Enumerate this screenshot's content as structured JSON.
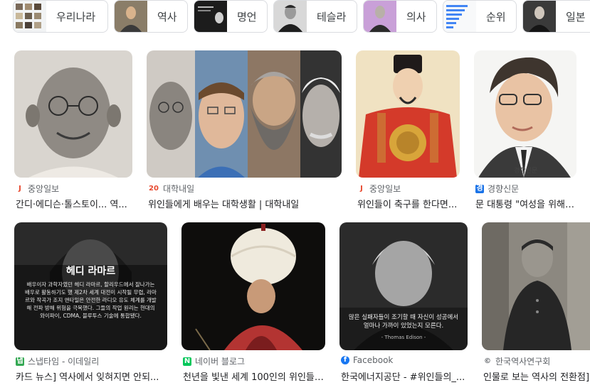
{
  "chips": [
    {
      "label": "우리나라",
      "icon": "world-map-thumbnail"
    },
    {
      "label": "역사",
      "icon": "portrait-thumbnail"
    },
    {
      "label": "명언",
      "icon": "quote-card-thumbnail"
    },
    {
      "label": "테슬라",
      "icon": "tesla-portrait-thumbnail"
    },
    {
      "label": "의사",
      "icon": "doctor-portrait-thumbnail"
    },
    {
      "label": "순위",
      "icon": "ranking-chart-thumbnail"
    },
    {
      "label": "일본",
      "icon": "portrait-thumbnail"
    }
  ],
  "row1": [
    {
      "source": "중앙일보",
      "favicon": "J",
      "favicon_color": "#e8492f",
      "title": "간디·에디슨·톨스토이... 역..."
    },
    {
      "source": "대학내일",
      "favicon": "20",
      "favicon_color": "#e8492f",
      "title": "위인들에게 배우는 대학생활 | 대학내일"
    },
    {
      "source": "중앙일보",
      "favicon": "J",
      "favicon_color": "#e8492f",
      "title": "위인들이 축구를 한다면..."
    },
    {
      "source": "경향신문",
      "favicon": "경",
      "favicon_color": "#1a73e8",
      "title": "문 대통령 \"여성을 위해 ..."
    }
  ],
  "row2": [
    {
      "source": "스냅타임 - 이데일리",
      "favicon": "냅",
      "favicon_color": "#34a853",
      "title": "카드 뉴스] 역사에서 잊혀지면 안되..."
    },
    {
      "source": "네이버 블로그",
      "favicon": "N",
      "favicon_color": "#03c75a",
      "title": "천년을 빛낸 세계 100인의 위인들 ..."
    },
    {
      "source": "Facebook",
      "favicon": "f",
      "favicon_color": "#1877f2",
      "title": "한국에너지공단 - #위인들의_..."
    },
    {
      "source": "한국역사연구회",
      "favicon": "©",
      "favicon_color": "#5f6368",
      "title": "인물로 보는 역사의 전환점]"
    }
  ],
  "overlays": {
    "hedy_title": "헤디 라마르",
    "hedy_body": "배우이자 과학자였던 헤디 라마르, 할리우드에서 잘나가는 배우로 활동하기도 했 제2차 세계 대전이 시작될 무렵, 라마르와 작곡가 조지 앤타일은 안전한 라디오 유도 체계를 개발해 전파 방해 위험을 극복했다. 그들의 작업 원리는 현대의 와이파이, CDMA, 블루투스 기술에 통합됐다.",
    "edison_quote": "많은 실패자들이 조기할 때 자신이 성공에서 얼마나 가까이 있었는지 모른다.",
    "edison_attr": "- Thomas Edison -",
    "moon_caption": "경향신문"
  }
}
